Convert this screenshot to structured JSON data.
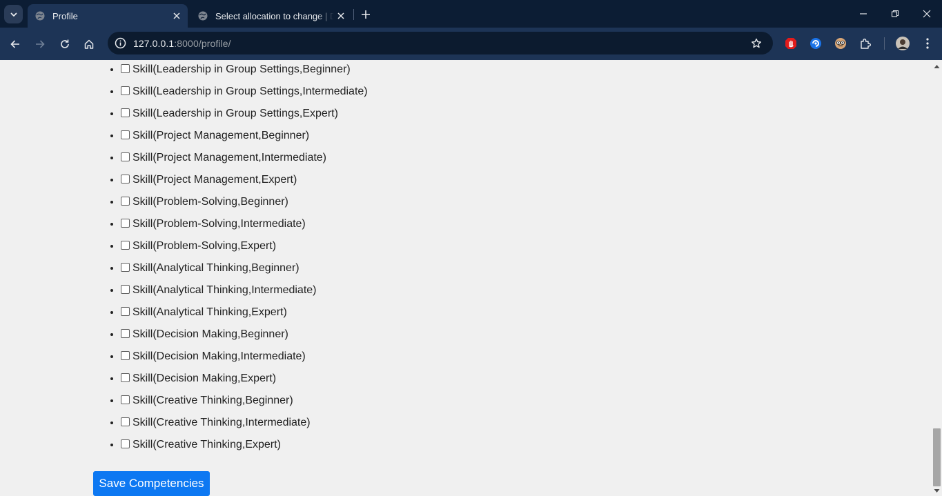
{
  "browser": {
    "tabs": [
      {
        "title": "Profile",
        "active": true
      },
      {
        "title": "Select allocation to change | Dja",
        "active": false
      }
    ],
    "address": {
      "host": "127.0.0.1",
      "path": ":8000/profile/"
    }
  },
  "skills": [
    "Skill(Leadership in Group Settings,Beginner)",
    "Skill(Leadership in Group Settings,Intermediate)",
    "Skill(Leadership in Group Settings,Expert)",
    "Skill(Project Management,Beginner)",
    "Skill(Project Management,Intermediate)",
    "Skill(Project Management,Expert)",
    "Skill(Problem-Solving,Beginner)",
    "Skill(Problem-Solving,Intermediate)",
    "Skill(Problem-Solving,Expert)",
    "Skill(Analytical Thinking,Beginner)",
    "Skill(Analytical Thinking,Intermediate)",
    "Skill(Analytical Thinking,Expert)",
    "Skill(Decision Making,Beginner)",
    "Skill(Decision Making,Intermediate)",
    "Skill(Decision Making,Expert)",
    "Skill(Creative Thinking,Beginner)",
    "Skill(Creative Thinking,Intermediate)",
    "Skill(Creative Thinking,Expert)"
  ],
  "form": {
    "save_label": "Save Competencies"
  },
  "colors": {
    "accent": "#0d78f2",
    "chrome_dark": "#0c1d34",
    "chrome_toolbar": "#1d3456",
    "page_bg": "#f0f0f0"
  },
  "icons": [
    "tab-search-icon",
    "globe-icon",
    "close-icon",
    "plus-icon",
    "minimize-icon",
    "restore-icon",
    "back-arrow-icon",
    "forward-arrow-icon",
    "reload-icon",
    "home-icon",
    "site-info-icon",
    "star-icon",
    "extension-icon",
    "profile-avatar",
    "kebab-menu-icon"
  ]
}
